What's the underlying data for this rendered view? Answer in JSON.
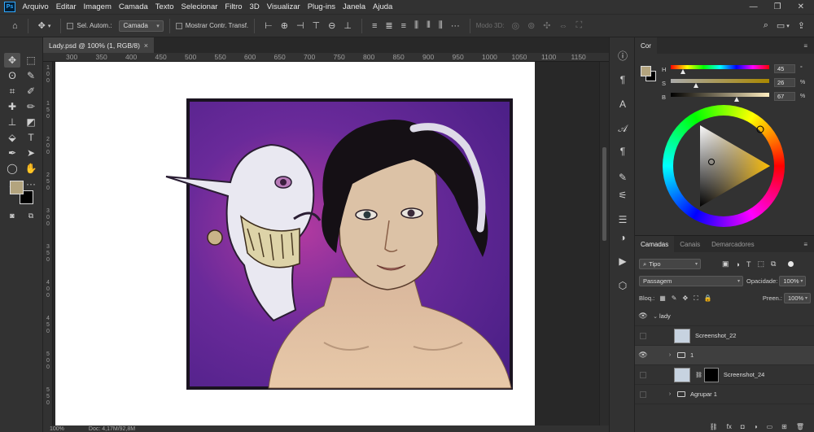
{
  "menubar": {
    "logo": "Ps",
    "items": [
      "Arquivo",
      "Editar",
      "Imagem",
      "Camada",
      "Texto",
      "Selecionar",
      "Filtro",
      "3D",
      "Visualizar",
      "Plug-ins",
      "Janela",
      "Ajuda"
    ],
    "window_controls": [
      "—",
      "❐",
      "✕"
    ]
  },
  "options": {
    "auto_select_label": "Sel. Autom.:",
    "auto_select_target": "Camada",
    "show_transform_label": "Mostrar Contr. Transf.",
    "mode_3d_label": "Modo 3D:"
  },
  "document": {
    "tab_title": "Lady.psd @ 100% (1, RGB/8)",
    "tab_close": "×",
    "ruler_top": [
      "300",
      "350",
      "400",
      "450",
      "500",
      "550",
      "600",
      "650",
      "700",
      "750",
      "800",
      "850",
      "900",
      "950",
      "1000",
      "1050",
      "1100",
      "1150"
    ],
    "ruler_left": [
      "1\n0\n0",
      "1\n5\n0",
      "2\n0\n0",
      "2\n5\n0",
      "3\n0\n0",
      "3\n5\n0",
      "4\n0\n0",
      "4\n5\n0",
      "5\n0\n0",
      "5\n5\n0"
    ],
    "zoom": "100%",
    "doc_size": "Doc: 4,17M/92,8M"
  },
  "color": {
    "panel_title": "Cor",
    "foreground": "#b3a47e",
    "background": "#000000",
    "h_label": "H",
    "h_value": "45",
    "h_unit": "°",
    "h_fraction": 0.125,
    "s_label": "S",
    "s_value": "26",
    "s_unit": "%",
    "s_fraction": 0.26,
    "b_label": "B",
    "b_value": "67",
    "b_unit": "%",
    "b_fraction": 0.67
  },
  "layers": {
    "tabs": [
      "Camadas",
      "Canais",
      "Demarcadores"
    ],
    "filter_kind": "Tipo",
    "blend_mode": "Passagem",
    "opacity_label": "Opacidade:",
    "opacity_value": "100%",
    "lock_label": "Bloq.:",
    "fill_label": "Preen.:",
    "fill_value": "100%",
    "items": [
      {
        "name": "lady",
        "kind": "group",
        "visible": true
      },
      {
        "name": "Screenshot_22",
        "kind": "image",
        "visible": false
      },
      {
        "name": "1",
        "kind": "group",
        "visible": true
      },
      {
        "name": "Screenshot_24",
        "kind": "masked",
        "visible": false
      },
      {
        "name": "Agrupar 1",
        "kind": "group",
        "visible": false
      }
    ]
  }
}
